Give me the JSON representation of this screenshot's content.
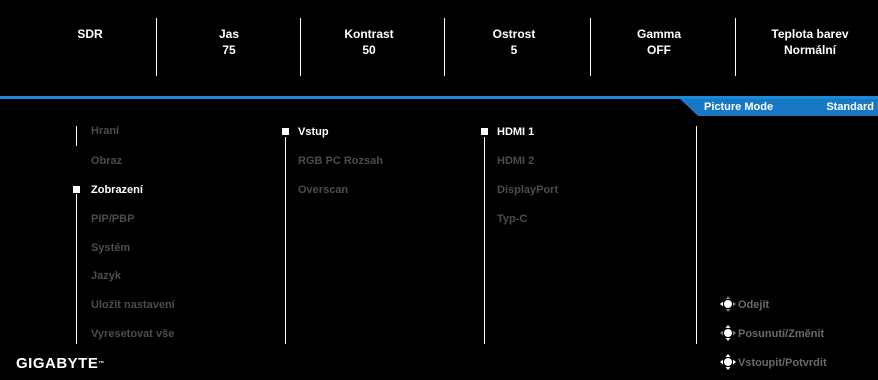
{
  "top_bar": {
    "items": [
      {
        "label": "SDR",
        "value": ""
      },
      {
        "label": "Jas",
        "value": "75"
      },
      {
        "label": "Kontrast",
        "value": "50"
      },
      {
        "label": "Ostrost",
        "value": "5"
      },
      {
        "label": "Gamma",
        "value": "OFF"
      },
      {
        "label": "Teplota barev",
        "value": "Normální"
      }
    ]
  },
  "picture_mode": {
    "label": "Picture Mode",
    "value": "Standard"
  },
  "menu": {
    "main_items": [
      "Hraní",
      "Obraz",
      "Zobrazení",
      "PIP/PBP",
      "Systém",
      "Jazyk",
      "Uložit nastavení",
      "Vyresetovat vše"
    ],
    "main_selected": "Zobrazení",
    "sub_items": [
      "Vstup",
      "RGB PC Rozsah",
      "Overscan"
    ],
    "sub_selected": "Vstup",
    "option_items": [
      "HDMI 1",
      "HDMI 2",
      "DisplayPort",
      "Typ-C"
    ],
    "option_selected": "HDMI 1"
  },
  "nav_help": {
    "exit": "Odejít",
    "move_change": "Posunutí/Změnit",
    "enter_confirm": "Vstoupit/Potvrdit"
  },
  "brand": {
    "logo_text": "GIGABYTE",
    "trademark": "™"
  },
  "colors": {
    "accent": "#1d8ad8",
    "tab": "#1878c4",
    "inactive_text": "#4c4c4c",
    "background": "#000000"
  }
}
